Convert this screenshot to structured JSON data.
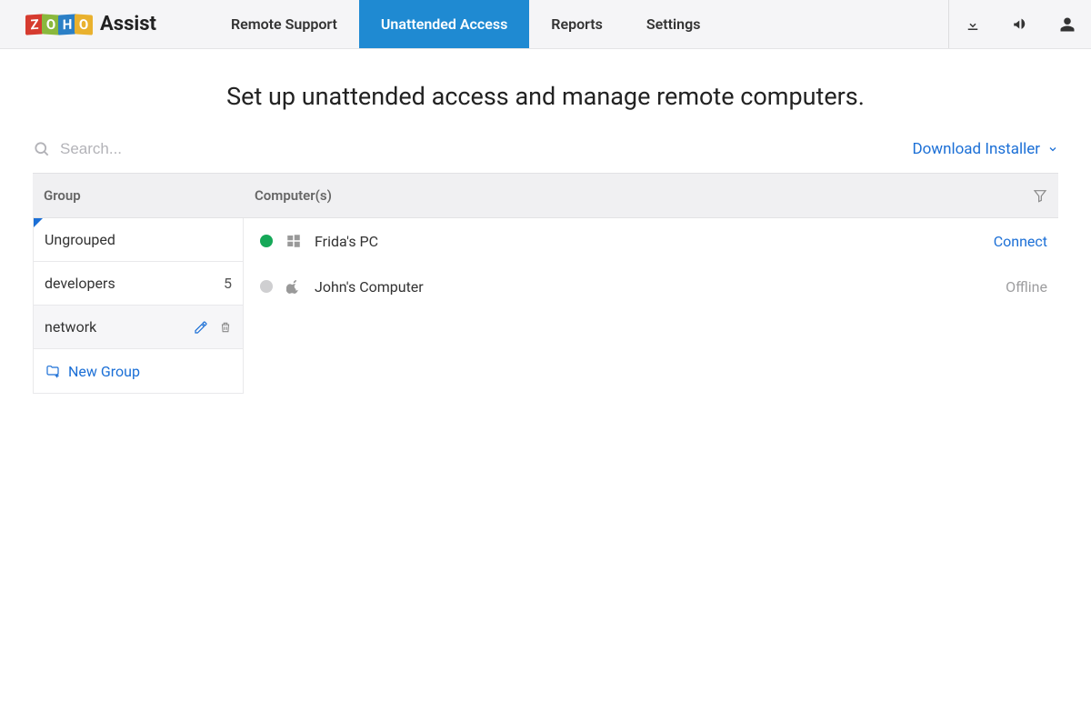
{
  "header": {
    "brand_assist": "Assist",
    "nav": [
      {
        "label": "Remote Support"
      },
      {
        "label": "Unattended Access",
        "active": true
      },
      {
        "label": "Reports"
      },
      {
        "label": "Settings"
      }
    ]
  },
  "page": {
    "title": "Set up unattended access and manage remote computers.",
    "search_placeholder": "Search...",
    "download_label": "Download Installer"
  },
  "table": {
    "col_group": "Group",
    "col_computers": "Computer(s)"
  },
  "groups": [
    {
      "name": "Ungrouped",
      "selected": true
    },
    {
      "name": "developers",
      "count": "5"
    },
    {
      "name": "network",
      "hovered": true
    }
  ],
  "new_group_label": "New Group",
  "computers": [
    {
      "name": "Frida's PC",
      "os": "windows",
      "status": "online",
      "action": "Connect"
    },
    {
      "name": "John's Computer",
      "os": "apple",
      "status": "offline",
      "action": "Offline"
    }
  ]
}
